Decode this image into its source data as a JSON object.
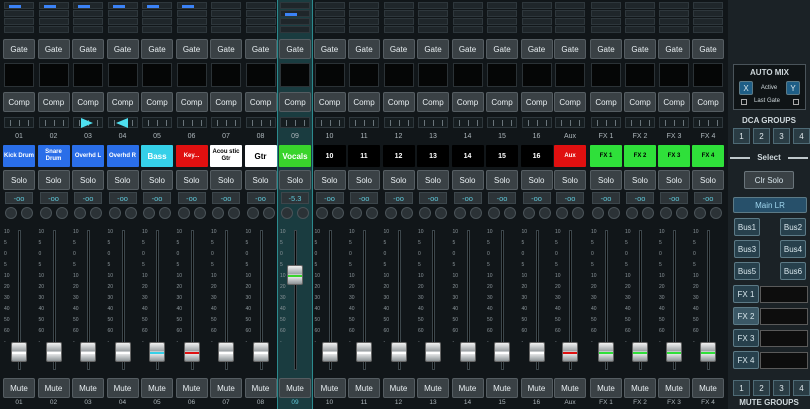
{
  "channels": [
    {
      "num": "01",
      "name": "Kick Drum",
      "color": "#2a6ee8",
      "text": "#ffffff",
      "value": "-oo",
      "foot": "01",
      "cap": "#ffffff",
      "meter": "blue"
    },
    {
      "num": "02",
      "name": "Snare Drum",
      "color": "#2a6ee8",
      "text": "#ffffff",
      "value": "-oo",
      "foot": "02",
      "cap": "#ffffff",
      "meter": "blue"
    },
    {
      "num": "03",
      "name": "Overhd L",
      "color": "#2a6ee8",
      "text": "#ffffff",
      "value": "-oo",
      "foot": "03",
      "cap": "#ffffff",
      "meter": "blue"
    },
    {
      "num": "04",
      "name": "Overhd R",
      "color": "#2a6ee8",
      "text": "#ffffff",
      "value": "-oo",
      "foot": "04",
      "cap": "#ffffff",
      "meter": "blue"
    },
    {
      "num": "05",
      "name": "Bass",
      "color": "#35d0e8",
      "text": "#ffffff",
      "value": "-oo",
      "foot": "05",
      "cap": "#35d0e8",
      "meter": "none"
    },
    {
      "num": "06",
      "name": "Key...",
      "color": "#e01010",
      "text": "#ffffff",
      "value": "-oo",
      "foot": "06",
      "cap": "#e01010",
      "meter": "blue"
    },
    {
      "num": "07",
      "name": "Acou stic Gtr",
      "color": "#ffffff",
      "text": "#000000",
      "value": "-oo",
      "foot": "07",
      "cap": "#ffffff",
      "meter": "blue"
    },
    {
      "num": "08",
      "name": "Gtr",
      "color": "#ffffff",
      "text": "#000000",
      "value": "-oo",
      "foot": "08",
      "cap": "#ffffff",
      "meter": "blue"
    },
    {
      "num": "09",
      "name": "Vocals",
      "color": "#39d42c",
      "text": "#ffffff",
      "value": "-5.3",
      "foot": "09",
      "cap": "#39d42c",
      "meter": "blue"
    },
    {
      "num": "10",
      "name": "10",
      "color": "#000000",
      "text": "#ffffff",
      "value": "-oo",
      "foot": "10",
      "cap": "#ffffff",
      "meter": "none"
    },
    {
      "num": "11",
      "name": "11",
      "color": "#000000",
      "text": "#ffffff",
      "value": "-oo",
      "foot": "11",
      "cap": "#ffffff",
      "meter": "none"
    },
    {
      "num": "12",
      "name": "12",
      "color": "#000000",
      "text": "#ffffff",
      "value": "-oo",
      "foot": "12",
      "cap": "#ffffff",
      "meter": "none"
    },
    {
      "num": "13",
      "name": "13",
      "color": "#000000",
      "text": "#ffffff",
      "value": "-oo",
      "foot": "13",
      "cap": "#ffffff",
      "meter": "none"
    },
    {
      "num": "14",
      "name": "14",
      "color": "#000000",
      "text": "#ffffff",
      "value": "-oo",
      "foot": "14",
      "cap": "#ffffff",
      "meter": "none"
    },
    {
      "num": "15",
      "name": "15",
      "color": "#000000",
      "text": "#ffffff",
      "value": "-oo",
      "foot": "15",
      "cap": "#ffffff",
      "meter": "none"
    },
    {
      "num": "16",
      "name": "16",
      "color": "#000000",
      "text": "#ffffff",
      "value": "-oo",
      "foot": "16",
      "cap": "#ffffff",
      "meter": "none"
    },
    {
      "num": "Aux",
      "name": "Aux",
      "color": "#e01010",
      "text": "#ffffff",
      "value": "-oo",
      "foot": "Aux",
      "cap": "#e01010",
      "meter": "none"
    },
    {
      "num": "FX 1",
      "name": "FX 1",
      "color": "#2fe03a",
      "text": "#000000",
      "value": "-oo",
      "foot": "FX 1",
      "cap": "#2fe03a",
      "meter": "none"
    },
    {
      "num": "FX 2",
      "name": "FX 2",
      "color": "#2fe03a",
      "text": "#000000",
      "value": "-oo",
      "foot": "FX 2",
      "cap": "#2fe03a",
      "meter": "none"
    },
    {
      "num": "FX 3",
      "name": "FX 3",
      "color": "#2fe03a",
      "text": "#000000",
      "value": "-oo",
      "foot": "FX 3",
      "cap": "#2fe03a",
      "meter": "none"
    },
    {
      "num": "FX 4",
      "name": "FX 4",
      "color": "#2fe03a",
      "text": "#000000",
      "value": "-oo",
      "foot": "FX 4",
      "cap": "#2fe03a",
      "meter": "none"
    }
  ],
  "labels": {
    "gate": "Gate",
    "comp": "Comp",
    "solo": "Solo",
    "mute": "Mute"
  },
  "fader_scale": [
    "10",
    "5",
    "0",
    "5",
    "10",
    "20",
    "30",
    "40",
    "50",
    "60",
    "-"
  ],
  "side": {
    "auto_mix": "AUTO MIX",
    "x": "X",
    "active": "Active",
    "y": "Y",
    "last_gate": "Last Gate",
    "dca_groups": "DCA GROUPS",
    "dca": [
      "1",
      "2",
      "3",
      "4"
    ],
    "select": "Select",
    "clr_solo": "Clr Solo",
    "main_lr": "Main LR",
    "bus": [
      "Bus1",
      "Bus2",
      "Bus3",
      "Bus4",
      "Bus5",
      "Bus6"
    ],
    "fx": [
      "FX 1",
      "FX 2",
      "FX 3",
      "FX 4"
    ],
    "mute_groups_nums": [
      "1",
      "2",
      "3",
      "4"
    ],
    "mute_groups": "MUTE GROUPS"
  }
}
